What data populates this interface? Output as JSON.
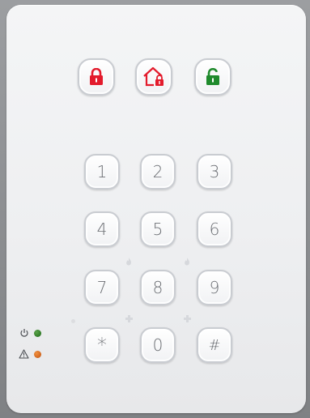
{
  "top_keys": [
    {
      "name": "arm-away-button",
      "icon": "lock-closed-icon",
      "color": "#e31b2c"
    },
    {
      "name": "arm-home-button",
      "icon": "home-lock-icon",
      "color": "#e31b2c"
    },
    {
      "name": "disarm-button",
      "icon": "lock-open-icon",
      "color": "#1f8a2c"
    }
  ],
  "keypad": {
    "k1": "1",
    "k2": "2",
    "k3": "3",
    "k4": "4",
    "k5": "5",
    "k6": "6",
    "k7": "7",
    "k8": "8",
    "k9": "9",
    "kstar": "*",
    "k0": "0",
    "khash": "#"
  },
  "indicators": {
    "power_icon": "power-icon",
    "power_led_color": "#2f7a26",
    "warning_icon": "warning-icon",
    "warning_led_color": "#d0651e"
  }
}
